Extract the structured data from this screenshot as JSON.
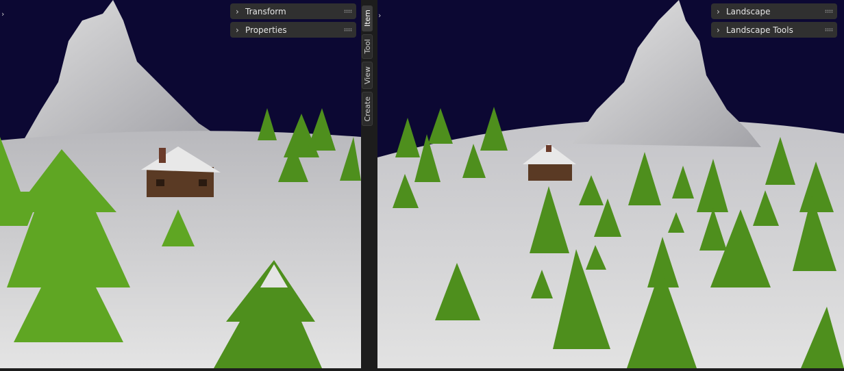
{
  "left_viewport": {
    "panels": [
      {
        "label": "Transform"
      },
      {
        "label": "Properties"
      }
    ]
  },
  "sidebar_tabs": [
    {
      "label": "Item",
      "active": true
    },
    {
      "label": "Tool",
      "active": false
    },
    {
      "label": "View",
      "active": false
    },
    {
      "label": "Create",
      "active": false
    }
  ],
  "right_viewport": {
    "panels": [
      {
        "label": "Landscape"
      },
      {
        "label": "Landscape Tools"
      }
    ]
  },
  "icons": {
    "panel_chevron": "chevron-right-icon",
    "panel_grip": "drag-grip-icon",
    "sidebar_toggle": "sidebar-toggle-icon"
  },
  "colors": {
    "sky": "#0c0833",
    "snow": "#d6d6d6",
    "tree": "#5fa623",
    "cabin": "#5a3a24",
    "panel_bg": "#303030",
    "ui_bg": "#1d1d1d"
  }
}
